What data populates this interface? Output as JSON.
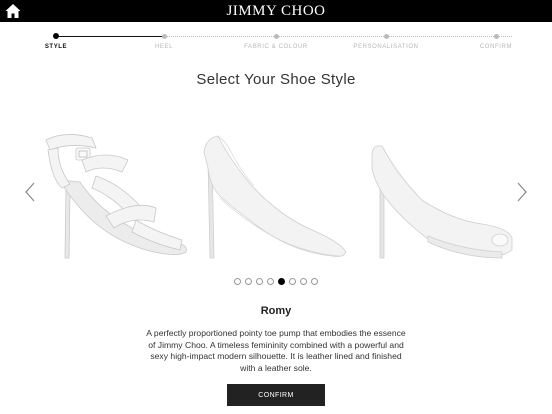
{
  "header": {
    "brand": "JIMMY CHOO",
    "home_icon": "home-icon"
  },
  "progress": {
    "steps": [
      {
        "label": "STYLE",
        "active": true
      },
      {
        "label": "HEEL",
        "active": false
      },
      {
        "label": "FABRIC & COLOUR",
        "active": false
      },
      {
        "label": "PERSONALISATION",
        "active": false
      },
      {
        "label": "CONFIRM",
        "active": false
      }
    ]
  },
  "main": {
    "title": "Select Your Shoe Style",
    "prev_icon": "chevron-left-icon",
    "next_icon": "chevron-right-icon",
    "shoes": [
      "strappy-sandal-image",
      "pointy-pump-image",
      "peep-toe-platform-image"
    ],
    "pager": {
      "count": 8,
      "active_index": 4
    },
    "selected_name": "Romy",
    "description": "A perfectly proportioned pointy toe pump that embodies the essence of Jimmy Choo. A timeless femininity combined with a powerful and sexy high-impact modern silhouette. It is leather lined and finished with a leather sole.",
    "confirm_label": "CONFIRM"
  },
  "colors": {
    "topbar": "#000000",
    "button": "#222222",
    "inactive_step": "#b8b8b8"
  }
}
